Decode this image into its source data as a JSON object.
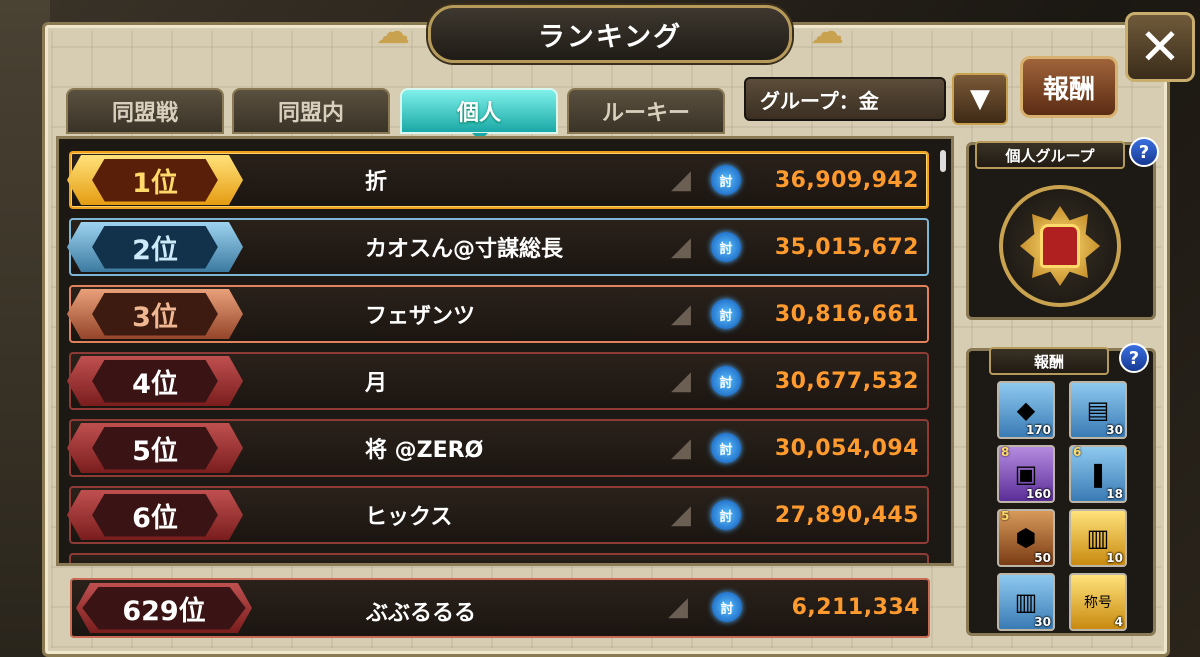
{
  "title": "ランキング",
  "close_label": "✕",
  "tabs": [
    {
      "label": "同盟戦",
      "active": false
    },
    {
      "label": "同盟内",
      "active": false
    },
    {
      "label": "個人",
      "active": true
    },
    {
      "label": "ルーキー",
      "active": false
    }
  ],
  "group_select": {
    "value": "グループ：金",
    "arrow": "▼"
  },
  "reward_button": "報酬",
  "ranking": [
    {
      "rank": "1位",
      "name": "折",
      "badge": "討",
      "score": "36,909,942",
      "tier": "gold"
    },
    {
      "rank": "2位",
      "name": "カオスん@寸謀総長",
      "badge": "討",
      "score": "35,015,672",
      "tier": "silver"
    },
    {
      "rank": "3位",
      "name": "フェザンツ",
      "badge": "討",
      "score": "30,816,661",
      "tier": "bronze"
    },
    {
      "rank": "4位",
      "name": "月",
      "badge": "討",
      "score": "30,677,532",
      "tier": "red"
    },
    {
      "rank": "5位",
      "name": "将 @ZERØ",
      "badge": "討",
      "score": "30,054,094",
      "tier": "red"
    },
    {
      "rank": "6位",
      "name": "ヒックス",
      "badge": "討",
      "score": "27,890,445",
      "tier": "red"
    }
  ],
  "self_rank": {
    "rank": "629位",
    "name": "ぶぶるるる",
    "badge": "討",
    "score": "6,211,334"
  },
  "group_panel": {
    "title": "個人グループ",
    "help": "?"
  },
  "reward_panel": {
    "title": "報酬",
    "help": "?",
    "items": [
      {
        "icon": "crystal-icon",
        "glyph": "◆",
        "count": "170",
        "level": "",
        "color": "blue"
      },
      {
        "icon": "scroll-icon",
        "glyph": "▤",
        "count": "30",
        "level": "",
        "color": "blue"
      },
      {
        "icon": "chest-icon",
        "glyph": "▣",
        "count": "160",
        "level": "8",
        "color": "purple"
      },
      {
        "icon": "blade-icon",
        "glyph": "❚",
        "count": "18",
        "level": "6",
        "color": "blue"
      },
      {
        "icon": "ore-icon",
        "glyph": "⬢",
        "count": "50",
        "level": "5",
        "color": "brown"
      },
      {
        "icon": "gold-ticket-icon",
        "glyph": "▥",
        "count": "10",
        "level": "",
        "color": "gold"
      },
      {
        "icon": "blue-ticket-icon",
        "glyph": "▥",
        "count": "30",
        "level": "",
        "color": "blue"
      },
      {
        "icon": "title-badge-icon",
        "glyph": "称号",
        "count": "4",
        "level": "",
        "color": "gold"
      }
    ]
  }
}
